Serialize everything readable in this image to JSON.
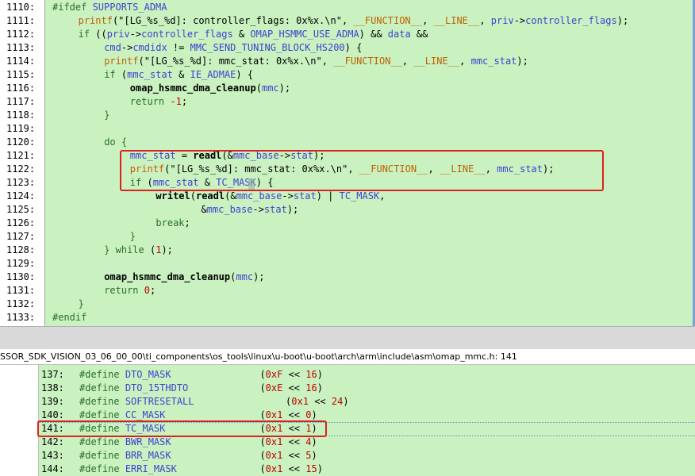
{
  "top": {
    "lines": [
      {
        "n": "1110:",
        "parts": [
          [
            "kw",
            "#ifdef "
          ],
          [
            "id",
            "SUPPORTS_ADMA"
          ]
        ],
        "indent": 0
      },
      {
        "n": "1111:",
        "parts": [
          [
            "mac",
            "printf"
          ],
          [
            "punc",
            "(\"[LG_%s_%d]: controller_flags: 0x%x.\\n\", "
          ],
          [
            "mac",
            "__FUNCTION__"
          ],
          [
            "punc",
            ", "
          ],
          [
            "mac",
            "__LINE__"
          ],
          [
            "punc",
            ", "
          ],
          [
            "id",
            "priv"
          ],
          [
            "punc",
            "->"
          ],
          [
            "id",
            "controller_flags"
          ],
          [
            "punc",
            ");"
          ]
        ],
        "indent": 4
      },
      {
        "n": "1112:",
        "parts": [
          [
            "kw",
            "if "
          ],
          [
            "punc",
            "(("
          ],
          [
            "id",
            "priv"
          ],
          [
            "punc",
            "->"
          ],
          [
            "id",
            "controller_flags"
          ],
          [
            "punc",
            " & "
          ],
          [
            "id",
            "OMAP_HSMMC_USE_ADMA"
          ],
          [
            "punc",
            ") && "
          ],
          [
            "id",
            "data"
          ],
          [
            "punc",
            " &&"
          ]
        ],
        "indent": 4
      },
      {
        "n": "1113:",
        "parts": [
          [
            "id",
            "cmd"
          ],
          [
            "punc",
            "->"
          ],
          [
            "id",
            "cmdidx"
          ],
          [
            "punc",
            " != "
          ],
          [
            "id",
            "MMC_SEND_TUNING_BLOCK_HS200"
          ],
          [
            "punc",
            ") {"
          ]
        ],
        "indent": 8
      },
      {
        "n": "1114:",
        "parts": [
          [
            "mac",
            "printf"
          ],
          [
            "punc",
            "(\"[LG_%s_%d]: mmc_stat: 0x%x.\\n\", "
          ],
          [
            "mac",
            "__FUNCTION__"
          ],
          [
            "punc",
            ", "
          ],
          [
            "mac",
            "__LINE__"
          ],
          [
            "punc",
            ", "
          ],
          [
            "id",
            "mmc_stat"
          ],
          [
            "punc",
            ");"
          ]
        ],
        "indent": 8
      },
      {
        "n": "1115:",
        "parts": [
          [
            "kw",
            "if "
          ],
          [
            "punc",
            "("
          ],
          [
            "id",
            "mmc_stat"
          ],
          [
            "punc",
            " & "
          ],
          [
            "id",
            "IE_ADMAE"
          ],
          [
            "punc",
            ") {"
          ]
        ],
        "indent": 8
      },
      {
        "n": "1116:",
        "parts": [
          [
            "fn",
            "omap_hsmmc_dma_cleanup"
          ],
          [
            "punc",
            "("
          ],
          [
            "id",
            "mmc"
          ],
          [
            "punc",
            ");"
          ]
        ],
        "indent": 12
      },
      {
        "n": "1117:",
        "parts": [
          [
            "kw",
            "return "
          ],
          [
            "num",
            "-1"
          ],
          [
            "punc",
            ";"
          ]
        ],
        "indent": 12
      },
      {
        "n": "1118:",
        "parts": [
          [
            "kw",
            "}"
          ]
        ],
        "indent": 8
      },
      {
        "n": "1119:",
        "parts": [],
        "indent": 0
      },
      {
        "n": "1120:",
        "parts": [
          [
            "kw",
            "do {"
          ]
        ],
        "indent": 8
      },
      {
        "n": "1121:",
        "parts": [
          [
            "id",
            "mmc_stat"
          ],
          [
            "punc",
            " = "
          ],
          [
            "fn",
            "readl"
          ],
          [
            "punc",
            "(&"
          ],
          [
            "id",
            "mmc_base"
          ],
          [
            "punc",
            "->"
          ],
          [
            "id",
            "stat"
          ],
          [
            "punc",
            ");"
          ]
        ],
        "indent": 12
      },
      {
        "n": "1122:",
        "parts": [
          [
            "mac",
            "printf"
          ],
          [
            "punc",
            "(\"[LG_%s_%d]: mmc_stat: 0x%x.\\n\", "
          ],
          [
            "mac",
            "__FUNCTION__"
          ],
          [
            "punc",
            ", "
          ],
          [
            "mac",
            "__LINE__"
          ],
          [
            "punc",
            ", "
          ],
          [
            "id",
            "mmc_stat"
          ],
          [
            "punc",
            ");"
          ]
        ],
        "indent": 12
      },
      {
        "n": "1123:",
        "parts": [
          [
            "kw",
            "if "
          ],
          [
            "punc",
            "("
          ],
          [
            "id",
            "mmc_stat"
          ],
          [
            "punc",
            " & "
          ],
          [
            "id",
            "TC_MASK"
          ],
          [
            "punc",
            ") {"
          ]
        ],
        "indent": 12
      },
      {
        "n": "1124:",
        "parts": [
          [
            "fn",
            "writel"
          ],
          [
            "punc",
            "("
          ],
          [
            "fn",
            "readl"
          ],
          [
            "punc",
            "(&"
          ],
          [
            "id",
            "mmc_base"
          ],
          [
            "punc",
            "->"
          ],
          [
            "id",
            "stat"
          ],
          [
            "punc",
            ") | "
          ],
          [
            "id",
            "TC_MASK"
          ],
          [
            "punc",
            ","
          ]
        ],
        "indent": 16
      },
      {
        "n": "1125:",
        "parts": [
          [
            "punc",
            "&"
          ],
          [
            "id",
            "mmc_base"
          ],
          [
            "punc",
            "->"
          ],
          [
            "id",
            "stat"
          ],
          [
            "punc",
            ");"
          ]
        ],
        "indent": 23
      },
      {
        "n": "1126:",
        "parts": [
          [
            "kw",
            "break"
          ],
          [
            "punc",
            ";"
          ]
        ],
        "indent": 16
      },
      {
        "n": "1127:",
        "parts": [
          [
            "kw",
            "}"
          ]
        ],
        "indent": 12
      },
      {
        "n": "1128:",
        "parts": [
          [
            "kw",
            "} while "
          ],
          [
            "punc",
            "("
          ],
          [
            "num",
            "1"
          ],
          [
            "punc",
            ");"
          ]
        ],
        "indent": 8
      },
      {
        "n": "1129:",
        "parts": [],
        "indent": 0
      },
      {
        "n": "1130:",
        "parts": [
          [
            "fn",
            "omap_hsmmc_dma_cleanup"
          ],
          [
            "punc",
            "("
          ],
          [
            "id",
            "mmc"
          ],
          [
            "punc",
            ");"
          ]
        ],
        "indent": 8
      },
      {
        "n": "1131:",
        "parts": [
          [
            "kw",
            "return "
          ],
          [
            "num",
            "0"
          ],
          [
            "punc",
            ";"
          ]
        ],
        "indent": 8
      },
      {
        "n": "1132:",
        "parts": [
          [
            "kw",
            "}"
          ]
        ],
        "indent": 4
      },
      {
        "n": "1133:",
        "parts": [
          [
            "kw",
            "#endif"
          ]
        ],
        "indent": 0
      }
    ]
  },
  "path_bar": {
    "text": "SSOR_SDK_VISION_03_06_00_00\\ti_components\\os_tools\\linux\\u-boot\\u-boot\\arch\\arm\\include\\asm\\omap_mmc.h: 141"
  },
  "bottom": {
    "lines": [
      {
        "n": "137:",
        "name": "DTO_MASK",
        "val": [
          [
            "punc",
            "("
          ],
          [
            "num",
            "0xF"
          ],
          [
            "punc",
            " << "
          ],
          [
            "num",
            "16"
          ],
          [
            "punc",
            ")"
          ]
        ],
        "pad": 23
      },
      {
        "n": "138:",
        "name": "DTO_15THDTO",
        "val": [
          [
            "punc",
            "("
          ],
          [
            "num",
            "0xE"
          ],
          [
            "punc",
            " << "
          ],
          [
            "num",
            "16"
          ],
          [
            "punc",
            ")"
          ]
        ],
        "pad": 23
      },
      {
        "n": "139:",
        "name": "SOFTRESETALL",
        "val": [
          [
            "punc",
            "("
          ],
          [
            "num",
            "0x1"
          ],
          [
            "punc",
            " << "
          ],
          [
            "num",
            "24"
          ],
          [
            "punc",
            ")"
          ]
        ],
        "pad": 27
      },
      {
        "n": "140:",
        "name": "CC_MASK",
        "val": [
          [
            "punc",
            "("
          ],
          [
            "num",
            "0x1"
          ],
          [
            "punc",
            " << "
          ],
          [
            "num",
            "0"
          ],
          [
            "punc",
            ")"
          ]
        ],
        "pad": 23
      },
      {
        "n": "141:",
        "name": "TC_MASK",
        "val": [
          [
            "punc",
            "("
          ],
          [
            "num",
            "0x1"
          ],
          [
            "punc",
            " << "
          ],
          [
            "num",
            "1"
          ],
          [
            "punc",
            ")"
          ]
        ],
        "pad": 23
      },
      {
        "n": "142:",
        "name": "BWR_MASK",
        "val": [
          [
            "punc",
            "("
          ],
          [
            "num",
            "0x1"
          ],
          [
            "punc",
            " << "
          ],
          [
            "num",
            "4"
          ],
          [
            "punc",
            ")"
          ]
        ],
        "pad": 23
      },
      {
        "n": "143:",
        "name": "BRR_MASK",
        "val": [
          [
            "punc",
            "("
          ],
          [
            "num",
            "0x1"
          ],
          [
            "punc",
            " << "
          ],
          [
            "num",
            "5"
          ],
          [
            "punc",
            ")"
          ]
        ],
        "pad": 23
      },
      {
        "n": "144:",
        "name": "ERRI_MASK",
        "val": [
          [
            "punc",
            "("
          ],
          [
            "num",
            "0x1"
          ],
          [
            "punc",
            " << "
          ],
          [
            "num",
            "15"
          ],
          [
            "punc",
            ")"
          ]
        ],
        "pad": 23
      }
    ],
    "define_kw": "#define"
  },
  "colors": {
    "highlight": "#e02020",
    "code_bg": "#c9f2c0"
  }
}
